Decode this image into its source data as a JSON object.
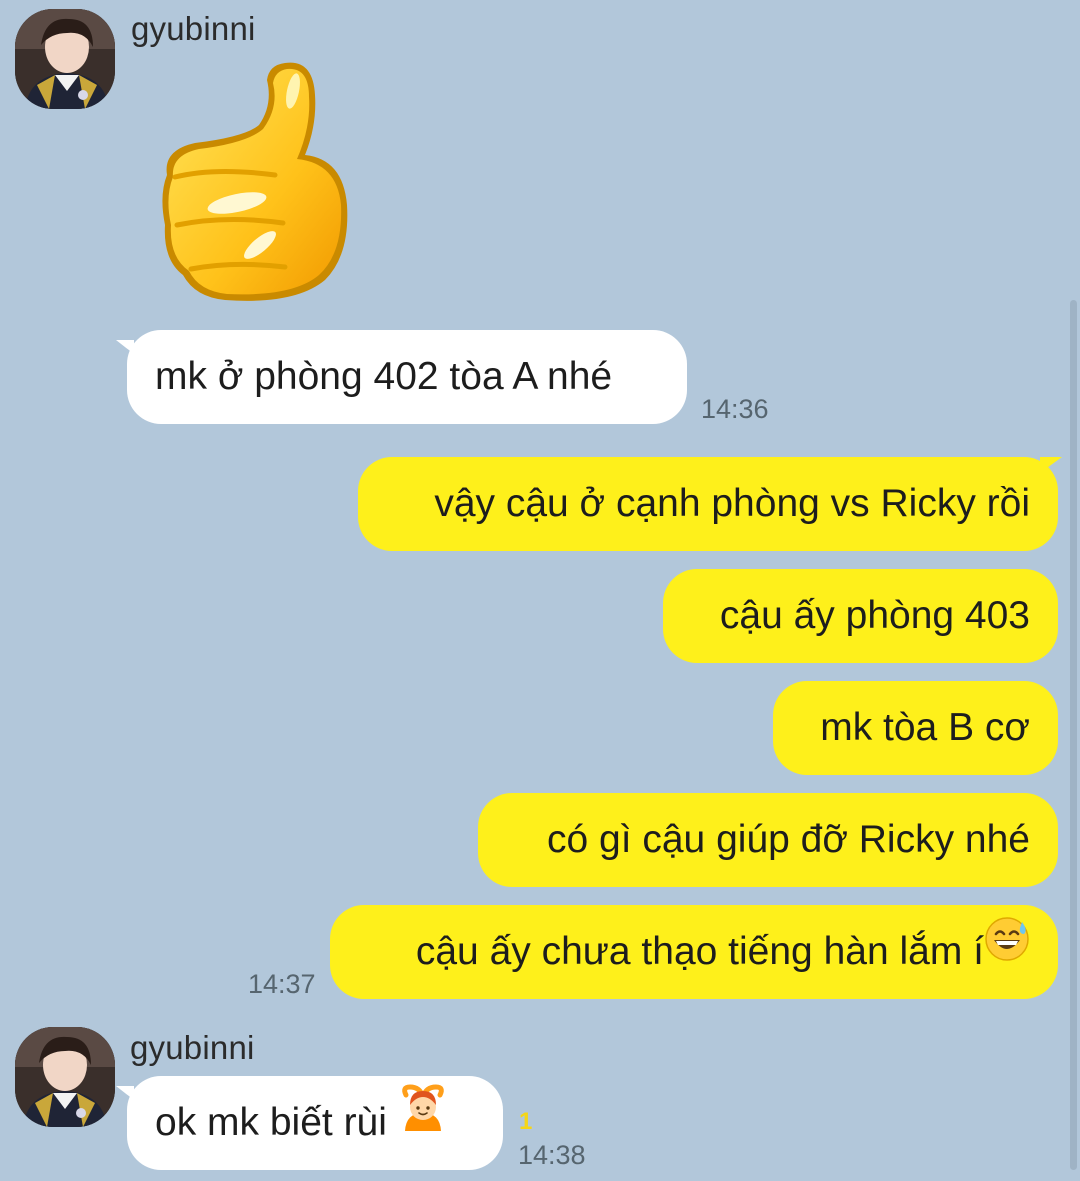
{
  "chat": {
    "colors": {
      "background": "#b2c7da",
      "incoming_bubble": "#ffffff",
      "outgoing_bubble": "#fef01b",
      "timestamp": "#56656f",
      "unread_count": "#f5d617"
    },
    "group1": {
      "sender": "gyubinni",
      "avatar": "profile-photo",
      "sticker": "thumbs-up-sticker",
      "message": "mk ở phòng 402 tòa A nhé",
      "time": "14:36"
    },
    "outgoing": {
      "messages": [
        "vậy cậu ở cạnh phòng vs Ricky rồi",
        "cậu ấy phòng 403",
        "mk tòa B cơ",
        "có gì cậu giúp đỡ Ricky nhé",
        "cậu ấy chưa thạo tiếng hàn lắm í"
      ],
      "last_emoji": "grinning-sweat-emoji",
      "time": "14:37"
    },
    "group2": {
      "sender": "gyubinni",
      "avatar": "profile-photo",
      "message": "ok mk biết rùi",
      "emoji": "person-gesturing-ok-emoji",
      "unread": "1",
      "time": "14:38"
    }
  }
}
